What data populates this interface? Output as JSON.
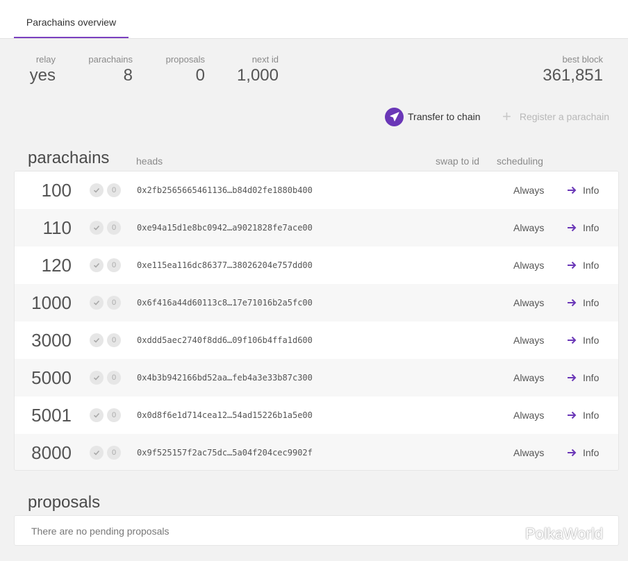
{
  "tabs": {
    "overview": "Parachains overview"
  },
  "summary": {
    "relay_label": "relay",
    "relay_value": "yes",
    "parachains_label": "parachains",
    "parachains_value": "8",
    "proposals_label": "proposals",
    "proposals_value": "0",
    "nextid_label": "next id",
    "nextid_value": "1,000",
    "bestblock_label": "best block",
    "bestblock_value": "361,851"
  },
  "actions": {
    "transfer_label": "Transfer to chain",
    "register_label": "Register a parachain"
  },
  "parachains": {
    "title": "parachains",
    "headers": {
      "heads": "heads",
      "swap": "swap to id",
      "scheduling": "scheduling"
    },
    "rows": [
      {
        "id": "100",
        "count": "0",
        "head": "0x2fb2565665461136…b84d02fe1880b400",
        "scheduling": "Always",
        "info": "Info"
      },
      {
        "id": "110",
        "count": "0",
        "head": "0xe94a15d1e8bc0942…a9021828fe7ace00",
        "scheduling": "Always",
        "info": "Info"
      },
      {
        "id": "120",
        "count": "0",
        "head": "0xe115ea116dc86377…38026204e757dd00",
        "scheduling": "Always",
        "info": "Info"
      },
      {
        "id": "1000",
        "count": "0",
        "head": "0x6f416a44d60113c8…17e71016b2a5fc00",
        "scheduling": "Always",
        "info": "Info"
      },
      {
        "id": "3000",
        "count": "0",
        "head": "0xddd5aec2740f8dd6…09f106b4ffa1d600",
        "scheduling": "Always",
        "info": "Info"
      },
      {
        "id": "5000",
        "count": "0",
        "head": "0x4b3b942166bd52aa…feb4a3e33b87c300",
        "scheduling": "Always",
        "info": "Info"
      },
      {
        "id": "5001",
        "count": "0",
        "head": "0x0d8f6e1d714cea12…54ad15226b1a5e00",
        "scheduling": "Always",
        "info": "Info"
      },
      {
        "id": "8000",
        "count": "0",
        "head": "0x9f525157f2ac75dc…5a04f204cec9902f",
        "scheduling": "Always",
        "info": "Info"
      }
    ]
  },
  "proposals": {
    "title": "proposals",
    "empty_text": "There are no pending proposals"
  },
  "watermark": {
    "text": "PolkaWorld"
  },
  "colors": {
    "accent": "#6a37b7",
    "tab_underline": "#7a3fbf",
    "arrow": "#6a37b7"
  },
  "icons": {
    "transfer": "paper-plane-icon",
    "register": "plus-icon",
    "check": "check-icon",
    "info": "arrow-right-icon",
    "watermark": "wechat-icon"
  }
}
